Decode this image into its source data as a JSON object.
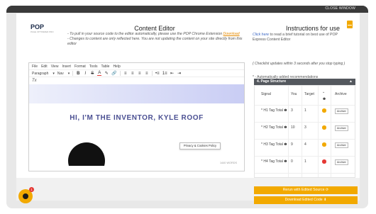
{
  "topbar": {
    "close_label": "CLOSE WINDOW"
  },
  "logo": {
    "text": "POP",
    "subtext": "PAGE OPTIMIZER PRO"
  },
  "left_panel": {
    "title": "Content Editor",
    "info_line1_prefix": "- To pull in your source code to the editor automatically, please use the POP Chrome Extension",
    "info_line1_link": "Download",
    "info_line2": "- Changes to content are only reflected here. You are not updating the content on your site directly from this editor"
  },
  "right_panel": {
    "title": "Instructions for use",
    "click_here": "Click here",
    "text": "to read a brief tutorial on best use of POP Express Content Editor",
    "checklist_note": "( Checklist updates within 3 seconds after you stop typing )",
    "auto_note": "* - Automatically added recommendations",
    "section_title": "4. Page Structure",
    "icon": "book-icon"
  },
  "editor": {
    "menus": [
      "File",
      "Edit",
      "View",
      "Insert",
      "Format",
      "Tools",
      "Table",
      "Help"
    ],
    "paragraph_select": "Paragraph",
    "font_select": "Nav",
    "toolbar_buttons": [
      {
        "name": "bold-button",
        "label": "B"
      },
      {
        "name": "italic-button",
        "label": "I"
      },
      {
        "name": "strikethrough-button",
        "label": "S"
      },
      {
        "name": "text-color-button",
        "label": "A"
      },
      {
        "name": "highlight-button",
        "label": "✎"
      },
      {
        "name": "link-button",
        "label": "🔗"
      },
      {
        "name": "align-left-button",
        "label": "≡"
      },
      {
        "name": "align-center-button",
        "label": "≡"
      },
      {
        "name": "align-right-button",
        "label": "≡"
      },
      {
        "name": "align-justify-button",
        "label": "≡"
      },
      {
        "name": "bullet-list-button",
        "label": "•≡"
      },
      {
        "name": "numbered-list-button",
        "label": "1≡"
      },
      {
        "name": "outdent-button",
        "label": "⇤"
      },
      {
        "name": "indent-button",
        "label": "⇥"
      }
    ],
    "clear_format": "Tx",
    "hero_heading": "HI, I'M THE INVENTOR, KYLE ROOF",
    "privacy_label": "Privacy & Cookies Policy",
    "status_text": "1440 WORDS"
  },
  "table": {
    "headers": {
      "signal": "Signal",
      "you": "You",
      "target": "Target",
      "archive": "Archive"
    },
    "rows": [
      {
        "signal": "* H1 Tag Total",
        "you": "3",
        "target": "1",
        "status_color": "#f2a900",
        "archive": "Archive"
      },
      {
        "signal": "* H2 Tag Total",
        "you": "10",
        "target": "3",
        "status_color": "#f2a900",
        "archive": "Archive"
      },
      {
        "signal": "* H3 Tag Total",
        "you": "9",
        "target": "4",
        "status_color": "#f2a900",
        "archive": "Archive"
      },
      {
        "signal": "* H4 Tag Total",
        "you": "0",
        "target": "1",
        "status_color": "#e53935",
        "archive": "Archive"
      }
    ]
  },
  "buttons": {
    "rerun": "Rerun with Edited Source ⟳",
    "download": "Download Edited Code ⬇"
  },
  "chat": {
    "badge_count": "1"
  },
  "colors": {
    "accent": "#f2a900",
    "danger": "#e53935",
    "heading": "#4a4f92"
  }
}
